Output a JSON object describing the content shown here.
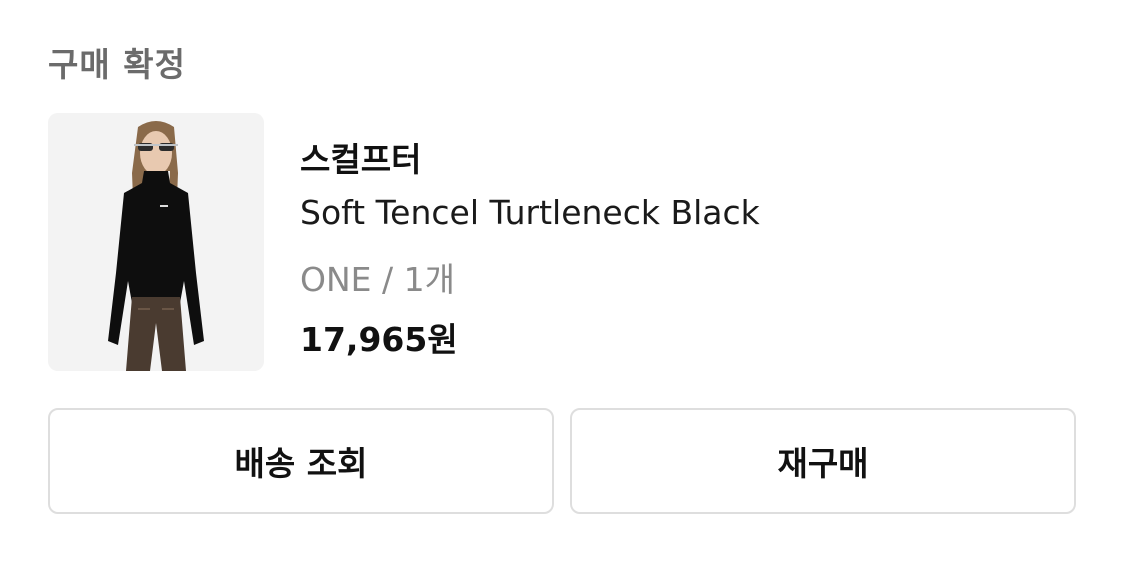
{
  "order": {
    "status": "구매 확정"
  },
  "product": {
    "brand": "스컬프터",
    "name": "Soft Tencel Turtleneck Black",
    "option": "ONE / 1개",
    "price": "17,965원",
    "image": "model-wearing-black-turtleneck"
  },
  "actions": {
    "track_delivery": "배송 조회",
    "repurchase": "재구매"
  },
  "colors": {
    "status_text": "#6b6b6b",
    "option_text": "#8a8a8a",
    "button_border": "#dedede",
    "thumb_bg": "#f3f3f3"
  }
}
